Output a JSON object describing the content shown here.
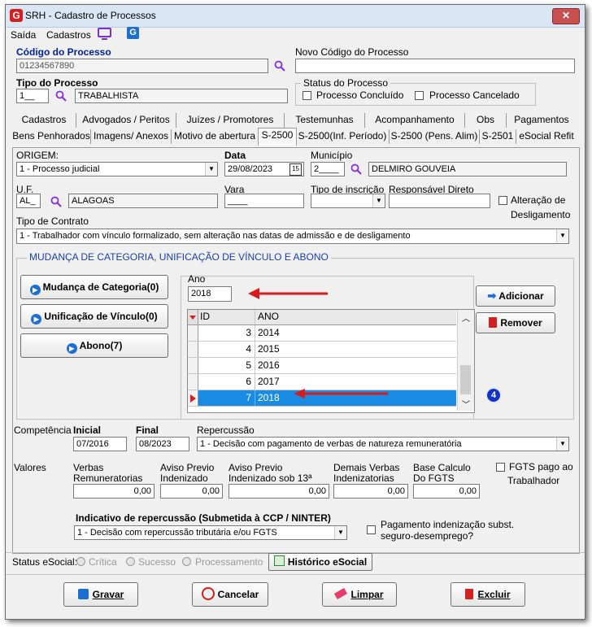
{
  "window": {
    "title": "SRH - Cadastro de Processos",
    "close_glyph": "✕"
  },
  "menu": {
    "saida": "Saída",
    "cadastros": "Cadastros"
  },
  "header": {
    "codigo_label": "Código do Processo",
    "codigo_value": "01234567890",
    "novo_codigo_label": "Novo Código do Processo",
    "novo_codigo_value": "",
    "tipo_label": "Tipo do Processo",
    "tipo_code": "1__",
    "tipo_desc": "TRABALHISTA",
    "status_label": "Status do Processo",
    "status_concluido": "Processo Concluído",
    "status_cancelado": "Processo Cancelado"
  },
  "tabs_row1": [
    "Cadastros",
    "Advogados / Peritos",
    "Juízes / Promotores",
    "Testemunhas",
    "Acompanhamento",
    "Obs",
    "Pagamentos"
  ],
  "tabs_row2": [
    "Bens Penhorados",
    "Imagens/ Anexos",
    "Motivo de abertura",
    "S-2500",
    "S-2500(Inf. Período)",
    "S-2500 (Pens. Alim)",
    "S-2501",
    "eSocial Refit"
  ],
  "form": {
    "origem_label": "ORIGEM:",
    "origem_value": "1 - Processo judicial",
    "data_label": "Data",
    "data_value": "29/08/2023",
    "calendar_glyph": "15",
    "municipio_label": "Município",
    "municipio_code": "2____",
    "municipio_desc": "DELMIRO GOUVEIA",
    "uf_label": "U.F.",
    "uf_code": "AL_",
    "uf_desc": "ALAGOAS",
    "vara_label": "Vara",
    "vara_value": "____",
    "tipo_inscricao_label": "Tipo de inscrição",
    "tipo_inscricao_value": "",
    "responsavel_label": "Responsável Direto",
    "responsavel_value": "",
    "alteracao_label_1": "Alteração de",
    "alteracao_label_2": "Desligamento",
    "tipo_contrato_label": "Tipo de Contrato",
    "tipo_contrato_value": "1 - Trabalhador com vínculo formalizado, sem alteração nas datas de admissão e de desligamento"
  },
  "section": {
    "title": "MUDANÇA DE CATEGORIA, UNIFICAÇÃO DE VÍNCULO E ABONO",
    "btn_mudanca": "Mudança de Categoria(0)",
    "btn_unificacao": "Unificação de Vínculo(0)",
    "btn_abono": "Abono(7)",
    "ano_label": "Ano",
    "ano_value": "2018",
    "btn_adicionar": "Adicionar",
    "btn_remover": "Remover",
    "badge": "4",
    "grid_headers": [
      "ID",
      "ANO"
    ],
    "grid_rows": [
      {
        "id": "3",
        "ano": "2014"
      },
      {
        "id": "4",
        "ano": "2015"
      },
      {
        "id": "5",
        "ano": "2016"
      },
      {
        "id": "6",
        "ano": "2017"
      },
      {
        "id": "7",
        "ano": "2018"
      }
    ]
  },
  "competencia": {
    "label": "Competência",
    "inicial_label": "Inicial",
    "inicial_value": "07/2016",
    "final_label": "Final",
    "final_value": "08/2023",
    "repercussao_label": "Repercussão",
    "repercussao_value": "1 - Decisão com pagamento de verbas de natureza remuneratória"
  },
  "valores": {
    "label": "Valores",
    "verbas_1": "Verbas",
    "verbas_2": "Remuneratorias",
    "verbas_value": "0,00",
    "aviso_1": "Aviso Previo",
    "aviso_2": "Indenizado",
    "aviso_value": "0,00",
    "aviso13_1": "Aviso Previo",
    "aviso13_2": "Indenizado sob 13ª",
    "aviso13_value": "0,00",
    "demais_1": "Demais Verbas",
    "demais_2": "Indenizatorias",
    "demais_value": "0,00",
    "base_1": "Base Calculo",
    "base_2": "Do FGTS",
    "base_value": "0,00",
    "fgts_1": "FGTS pago ao",
    "fgts_2": "Trabalhador"
  },
  "indicativo": {
    "label": "Indicativo de repercussão (Submetida à CCP / NINTER)",
    "value": "1 - Decisão com repercussão tributária e/ou FGTS",
    "pagamento_1": "Pagamento indenização subst.",
    "pagamento_2": "seguro-desemprego?"
  },
  "status_esocial": {
    "label": "Status eSocial:",
    "critica": "Crítica",
    "sucesso": "Sucesso",
    "processamento": "Processamento",
    "historico": "Histórico eSocial"
  },
  "footer": {
    "gravar": "Gravar",
    "cancelar": "Cancelar",
    "limpar": "Limpar",
    "excluir": "Excluir"
  },
  "colors": {
    "accent": "#1a8be3",
    "arrow_red": "#d81b1b",
    "search_purple": "#8a2be2",
    "delete_red": "#d32020"
  }
}
